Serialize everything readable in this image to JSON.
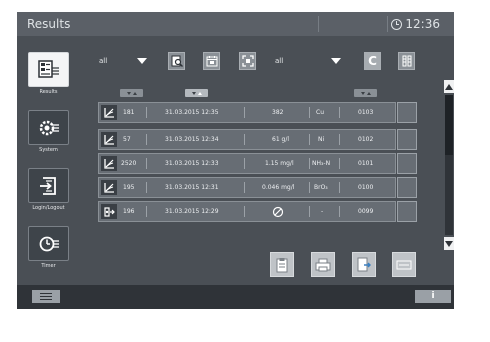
{
  "titlebar": {
    "title": "Results",
    "time": "12:36"
  },
  "sidebar": {
    "items": [
      {
        "label": "Results",
        "icon": "results-list-icon",
        "active": true
      },
      {
        "label": "System",
        "icon": "system-settings-icon",
        "active": false
      },
      {
        "label": "Login/Logout",
        "icon": "login-logout-icon",
        "active": false
      },
      {
        "label": "Timer",
        "icon": "timer-icon",
        "active": false
      }
    ]
  },
  "toolbar": {
    "filter1": "all",
    "filter2": "all",
    "clear_label": "C"
  },
  "results": [
    {
      "icon": "measurement-chart-icon",
      "id": "181",
      "datetime": "31.03.2015 12:35",
      "value": "382",
      "param": "Cu",
      "method": "0103"
    },
    {
      "icon": "measurement-chart-icon",
      "id": "57",
      "datetime": "31.03.2015 12:34",
      "value": "61 g/l",
      "param": "Ni",
      "method": "0102"
    },
    {
      "icon": "measurement-chart-icon",
      "id": "2520",
      "datetime": "31.03.2015 12:33",
      "value": "1.15 mg/l",
      "param": "NH₃-N",
      "method": "0101"
    },
    {
      "icon": "measurement-chart-icon",
      "id": "195",
      "datetime": "31.03.2015 12:31",
      "value": "0.046 mg/l",
      "param": "BrO₃",
      "method": "0100"
    },
    {
      "icon": "reference-measurement-icon",
      "id": "196",
      "datetime": "31.03.2015 12:29",
      "value": "",
      "param": "-",
      "method": "0099"
    }
  ],
  "bottom": {
    "info_label": "i"
  },
  "colors": {
    "screen_bg": "#4a4f55",
    "titlebar_bg": "#5b6067",
    "bottom_bar_bg": "#2f3338"
  }
}
